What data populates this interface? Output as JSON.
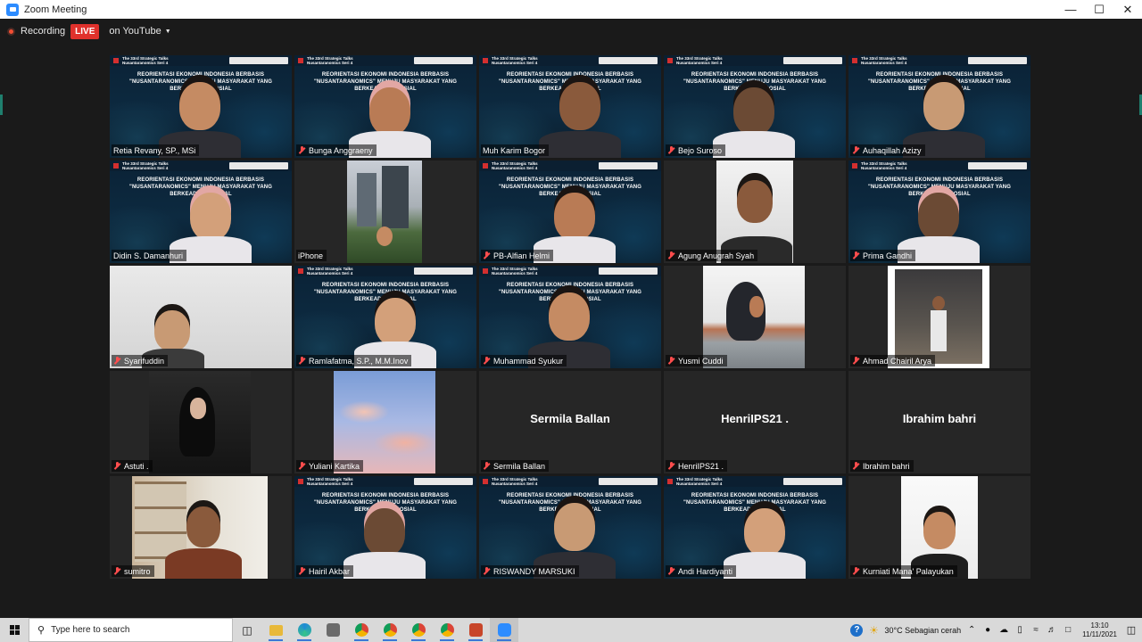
{
  "window": {
    "title": "Zoom Meeting"
  },
  "topbar": {
    "recording_label": "Recording",
    "live_label": "LIVE",
    "youtube_label": "on YouTube"
  },
  "slide": {
    "series": "The 33rd Strategic Talks\nNusantaranomics Seri 4",
    "banner_full": "REORIENTASI EKONOMI INDONESIA BERBASIS \"NUSANTARANOMICS\" MENUJU MASYARAKAT YANG BERKEADILAN SOSIAL"
  },
  "participants": [
    {
      "name": "Retia Revany, SP., MSi",
      "style": "slide",
      "active": true,
      "muted": false
    },
    {
      "name": "Bunga Anggraeny",
      "style": "slide",
      "muted": true
    },
    {
      "name": "Muh Karim Bogor",
      "style": "slide",
      "muted": false
    },
    {
      "name": "Bejo Suroso",
      "style": "slide",
      "muted": true
    },
    {
      "name": "Auhaqillah Azizy",
      "style": "slide",
      "muted": true
    },
    {
      "name": "Didin S. Damanhuri",
      "style": "slide",
      "muted": false
    },
    {
      "name": "iPhone",
      "style": "city",
      "muted": false
    },
    {
      "name": "PB-Alfian Helmi",
      "style": "slide",
      "muted": true
    },
    {
      "name": "Agung Anugrah Syah",
      "style": "selfie",
      "muted": true
    },
    {
      "name": "Prima Gandhi",
      "style": "slide",
      "muted": true
    },
    {
      "name": "Syarifuddin",
      "style": "room",
      "muted": true
    },
    {
      "name": "Ramlafatma, S.P., M.M.Inov",
      "style": "slide",
      "muted": true
    },
    {
      "name": "Muhammad Syukur",
      "style": "slide",
      "muted": true
    },
    {
      "name": "Yusmi Cuddi",
      "style": "outdoor",
      "muted": true
    },
    {
      "name": "Ahmad Chairil Arya",
      "style": "photo",
      "muted": true
    },
    {
      "name": "Astuti .",
      "style": "dark",
      "muted": true
    },
    {
      "name": "Yuliani Kartika",
      "style": "sky",
      "muted": true
    },
    {
      "name": "Sermila Ballan",
      "style": "text",
      "muted": true,
      "big": "Sermila Ballan"
    },
    {
      "name": "HenriIPS21 .",
      "style": "text",
      "muted": true,
      "big": "HenriIPS21 ."
    },
    {
      "name": "Ibrahim bahri",
      "style": "text",
      "muted": true,
      "big": "Ibrahim bahri"
    },
    {
      "name": "sumitro",
      "style": "books",
      "muted": true
    },
    {
      "name": "Hairil Akbar",
      "style": "slide",
      "muted": true
    },
    {
      "name": "RISWANDY MARSUKI",
      "style": "slide",
      "muted": true
    },
    {
      "name": "Andi Hardiyanti",
      "style": "slide",
      "muted": true
    },
    {
      "name": "Kurniati Mana' Palayukan",
      "style": "bright",
      "muted": true
    }
  ],
  "taskbar": {
    "search_placeholder": "Type here to search",
    "weather": "30°C  Sebagian cerah",
    "time": "13:10",
    "date": "11/11/2021"
  },
  "colors": {
    "active_speaker": "#d4e24b",
    "live": "#e0312c",
    "muted_mic": "#ff4d4d"
  }
}
